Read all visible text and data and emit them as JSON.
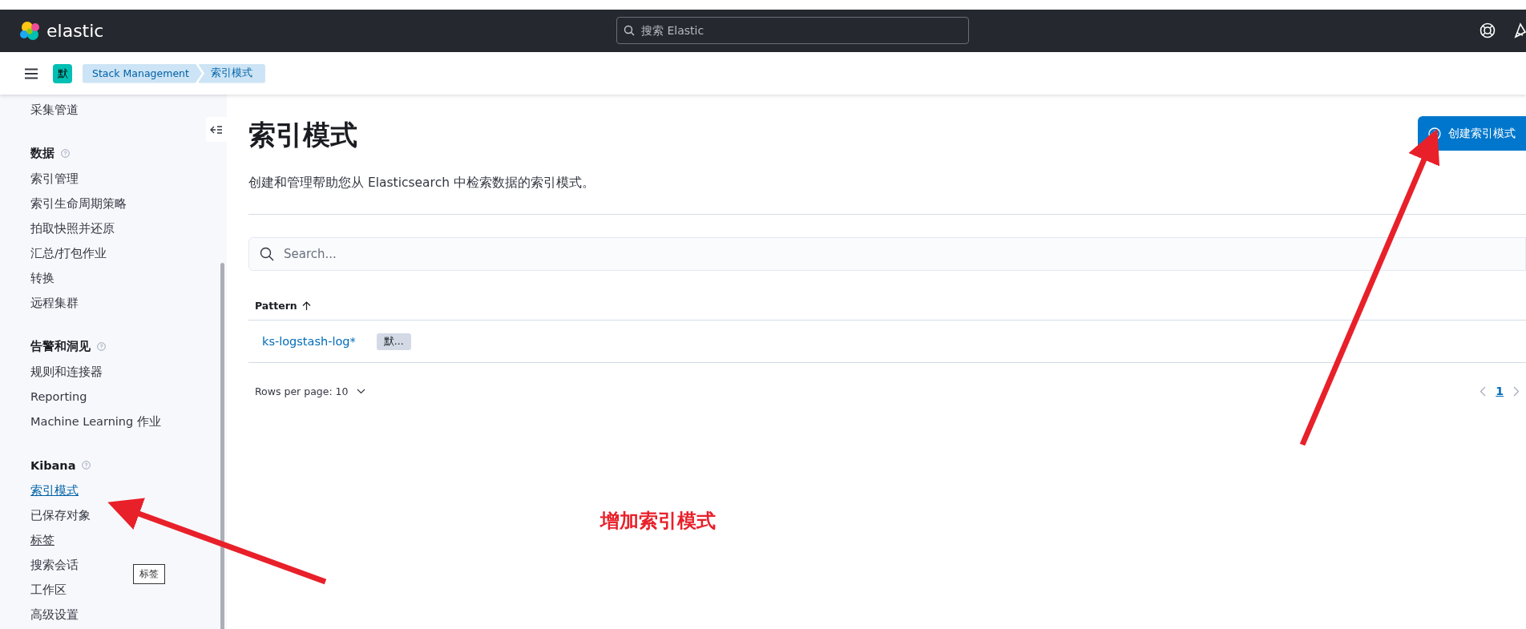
{
  "header": {
    "logo": "elastic",
    "search": {
      "placeholder": "搜索 Elastic"
    }
  },
  "subheader": {
    "space_avatar": "默",
    "breadcrumbs": [
      "Stack Management",
      "索引模式"
    ]
  },
  "sidebar": {
    "top_items": [
      {
        "label": "采集管道",
        "selected": false,
        "hovered": false
      }
    ],
    "groups": [
      {
        "title": "数据",
        "items": [
          {
            "label": "索引管理",
            "selected": false,
            "hovered": false
          },
          {
            "label": "索引生命周期策略",
            "selected": false,
            "hovered": false
          },
          {
            "label": "拍取快照并还原",
            "selected": false,
            "hovered": false
          },
          {
            "label": "汇总/打包作业",
            "selected": false,
            "hovered": false
          },
          {
            "label": "转换",
            "selected": false,
            "hovered": false
          },
          {
            "label": "远程集群",
            "selected": false,
            "hovered": false
          }
        ]
      },
      {
        "title": "告警和洞见",
        "items": [
          {
            "label": "规则和连接器",
            "selected": false,
            "hovered": false
          },
          {
            "label": "Reporting",
            "selected": false,
            "hovered": false
          },
          {
            "label": "Machine Learning 作业",
            "selected": false,
            "hovered": false
          }
        ]
      },
      {
        "title": "Kibana",
        "items": [
          {
            "label": "索引模式",
            "selected": true,
            "hovered": false
          },
          {
            "label": "已保存对象",
            "selected": false,
            "hovered": false
          },
          {
            "label": "标签",
            "selected": false,
            "hovered": true
          },
          {
            "label": "搜索会话",
            "selected": false,
            "hovered": false
          },
          {
            "label": "工作区",
            "selected": false,
            "hovered": false
          },
          {
            "label": "高级设置",
            "selected": false,
            "hovered": false
          }
        ]
      }
    ],
    "tooltip": "标签"
  },
  "main": {
    "title": "索引模式",
    "description": "创建和管理帮助您从 Elasticsearch 中检索数据的索引模式。",
    "create_button": "创建索引模式",
    "search": {
      "placeholder": "Search..."
    },
    "table": {
      "columns": [
        "Pattern"
      ],
      "rows": [
        {
          "pattern": "ks-logstash-log*",
          "badge": "默..."
        }
      ]
    },
    "rows_per_page": "Rows per page: 10",
    "pagination": [
      {
        "label": "1",
        "selected": true
      }
    ]
  },
  "annotation": {
    "label": "增加索引模式"
  }
}
